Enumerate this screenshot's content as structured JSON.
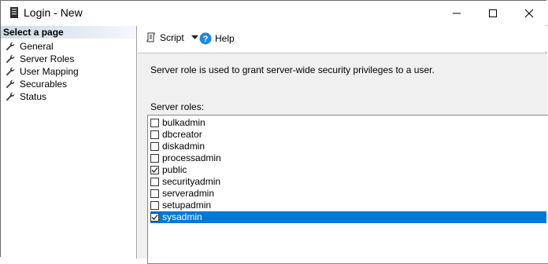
{
  "window": {
    "title": "Login - New"
  },
  "sidebar": {
    "header": "Select a page",
    "items": [
      {
        "label": "General",
        "icon": "wrench-icon"
      },
      {
        "label": "Server Roles",
        "icon": "wrench-icon"
      },
      {
        "label": "User Mapping",
        "icon": "wrench-icon"
      },
      {
        "label": "Securables",
        "icon": "wrench-icon"
      },
      {
        "label": "Status",
        "icon": "wrench-icon"
      }
    ]
  },
  "toolbar": {
    "script_label": "Script",
    "help_label": "Help"
  },
  "main": {
    "description": "Server role is used to grant server-wide security privileges to a user.",
    "roles_label": "Server roles:",
    "roles": [
      {
        "name": "bulkadmin",
        "checked": false,
        "selected": false
      },
      {
        "name": "dbcreator",
        "checked": false,
        "selected": false
      },
      {
        "name": "diskadmin",
        "checked": false,
        "selected": false
      },
      {
        "name": "processadmin",
        "checked": false,
        "selected": false
      },
      {
        "name": "public",
        "checked": true,
        "selected": false
      },
      {
        "name": "securityadmin",
        "checked": false,
        "selected": false
      },
      {
        "name": "serveradmin",
        "checked": false,
        "selected": false
      },
      {
        "name": "setupadmin",
        "checked": false,
        "selected": false
      },
      {
        "name": "sysadmin",
        "checked": true,
        "selected": true
      }
    ]
  },
  "colors": {
    "selection": "#0078d7",
    "help_icon": "#1e88e5",
    "panel_bg": "#f0f0f0"
  }
}
